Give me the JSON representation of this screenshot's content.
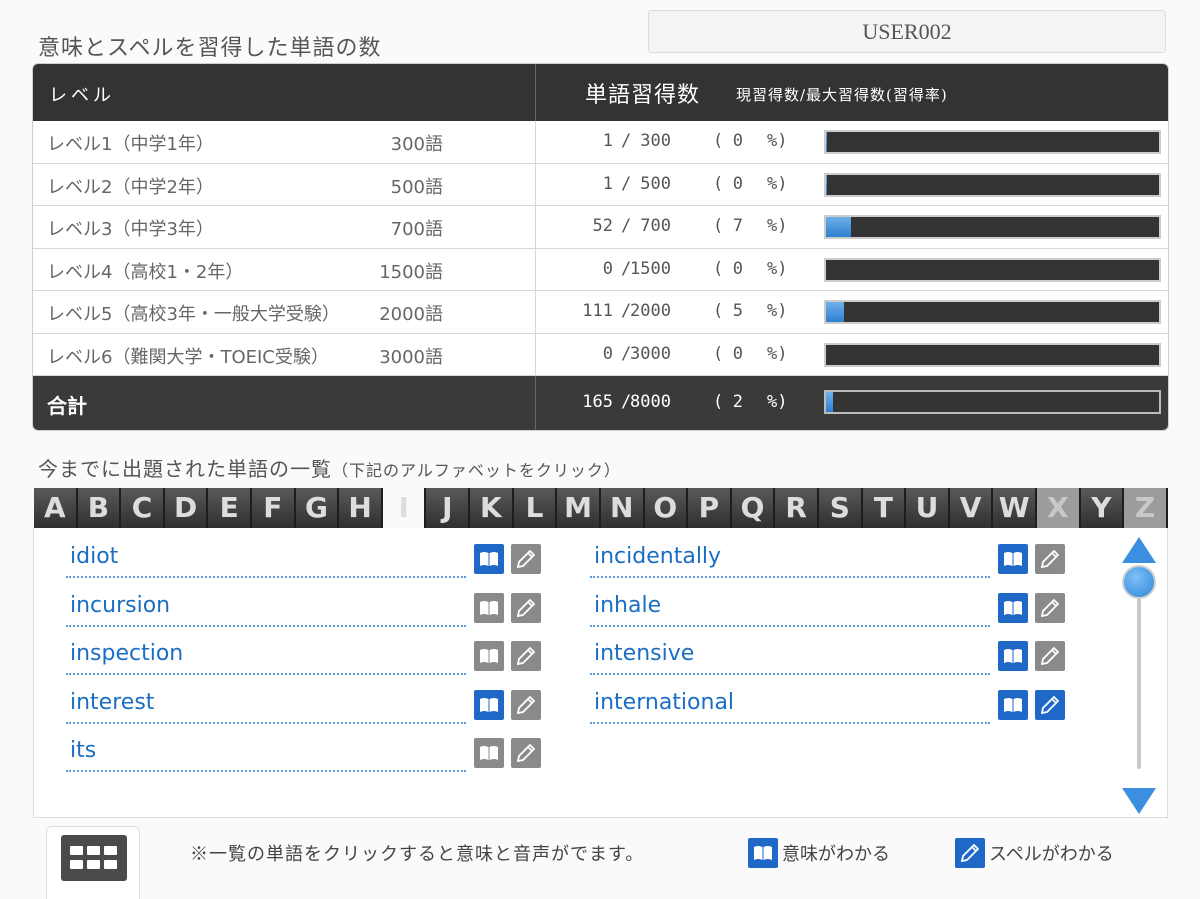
{
  "header": {
    "title": "意味とスペルを習得した単語の数",
    "user": "USER002"
  },
  "progress_table": {
    "col_level": "レベル",
    "col_count": "単語習得数",
    "col_count_note": "現習得数/最大習得数(習得率)",
    "rows": [
      {
        "level": "レベル1（中学1年）",
        "words": "300語",
        "current": "1",
        "max": "300",
        "percent": "0",
        "fraction": 0.003
      },
      {
        "level": "レベル2（中学2年）",
        "words": "500語",
        "current": "1",
        "max": "500",
        "percent": "0",
        "fraction": 0.002
      },
      {
        "level": "レベル3（中学3年）",
        "words": "700語",
        "current": "52",
        "max": "700",
        "percent": "7",
        "fraction": 0.074
      },
      {
        "level": "レベル4（高校1・2年）",
        "words": "1500語",
        "current": "0",
        "max": "1500",
        "percent": "0",
        "fraction": 0
      },
      {
        "level": "レベル5（高校3年・一般大学受験）",
        "words": "2000語",
        "current": "111",
        "max": "2000",
        "percent": "5",
        "fraction": 0.055
      },
      {
        "level": "レベル6（難関大学・TOEIC受験）",
        "words": "3000語",
        "current": "0",
        "max": "3000",
        "percent": "0",
        "fraction": 0
      }
    ],
    "total": {
      "label": "合計",
      "current": "165",
      "max": "8000",
      "percent": "2",
      "fraction": 0.021
    },
    "slash": "/",
    "paren_open": "(",
    "percent_close": "%)"
  },
  "word_list": {
    "title": "今までに出題された単語の一覧",
    "hint": "（下記のアルファベットをクリック）",
    "letters": [
      "A",
      "B",
      "C",
      "D",
      "E",
      "F",
      "G",
      "H",
      "I",
      "J",
      "K",
      "L",
      "M",
      "N",
      "O",
      "P",
      "Q",
      "R",
      "S",
      "T",
      "U",
      "V",
      "W",
      "X",
      "Y",
      "Z"
    ],
    "selected_letter": "I",
    "disabled_letters": [
      "X",
      "Z"
    ],
    "words": [
      {
        "word": "idiot",
        "meaning": true,
        "spelling": false
      },
      {
        "word": "incidentally",
        "meaning": true,
        "spelling": false
      },
      {
        "word": "incursion",
        "meaning": false,
        "spelling": false
      },
      {
        "word": "inhale",
        "meaning": true,
        "spelling": false
      },
      {
        "word": "inspection",
        "meaning": false,
        "spelling": false
      },
      {
        "word": "intensive",
        "meaning": true,
        "spelling": false
      },
      {
        "word": "interest",
        "meaning": true,
        "spelling": false
      },
      {
        "word": "international",
        "meaning": true,
        "spelling": true
      },
      {
        "word": "its",
        "meaning": false,
        "spelling": false
      }
    ]
  },
  "footer": {
    "note": "※一覧の単語をクリックすると意味と音声がでます。",
    "legend_meaning": "意味がわかる",
    "legend_spelling": "スペルがわかる"
  },
  "colors": {
    "accent": "#1f68c8",
    "header_bg": "#333333",
    "inactive_icon": "#8a8a8a"
  },
  "icons": [
    "book-icon",
    "pencil-icon",
    "grid-menu-icon",
    "arrow-up-icon",
    "arrow-down-icon"
  ]
}
